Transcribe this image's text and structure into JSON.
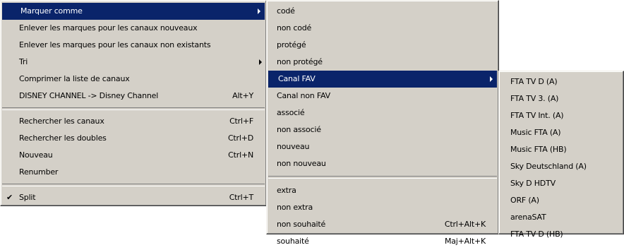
{
  "main_menu": {
    "items": [
      {
        "label": "Marquer comme",
        "shortcut": "",
        "submenu": true,
        "selected": true
      },
      {
        "label": "Enlever les marques pour les canaux nouveaux",
        "shortcut": ""
      },
      {
        "label": "Enlever les marques pour les canaux non existants",
        "shortcut": ""
      },
      {
        "label": "Tri",
        "shortcut": "",
        "submenu": true
      },
      {
        "label": "Comprimer la liste de canaux",
        "shortcut": ""
      },
      {
        "label": "DISNEY CHANNEL -> Disney Channel",
        "shortcut": "Alt+Y"
      },
      {
        "label": "Rechercher les canaux",
        "shortcut": "Ctrl+F"
      },
      {
        "label": "Rechercher les doubles",
        "shortcut": "Ctrl+D"
      },
      {
        "label": "Nouveau",
        "shortcut": "Ctrl+N"
      },
      {
        "label": "Renumber",
        "shortcut": ""
      },
      {
        "label": "Split",
        "shortcut": "Ctrl+T",
        "checked": true
      }
    ]
  },
  "mark_submenu": {
    "items": [
      {
        "label": "codé"
      },
      {
        "label": "non codé"
      },
      {
        "label": "protégé"
      },
      {
        "label": "non protégé"
      },
      {
        "label": "Canal FAV",
        "submenu": true,
        "selected": true
      },
      {
        "label": "Canal non FAV"
      },
      {
        "label": "associé"
      },
      {
        "label": "non associé"
      },
      {
        "label": "nouveau"
      },
      {
        "label": "non nouveau"
      },
      {
        "label": "extra"
      },
      {
        "label": "non extra"
      },
      {
        "label": "non souhaité",
        "shortcut": "Ctrl+Alt+K"
      },
      {
        "label": "souhaité",
        "shortcut": "Maj+Alt+K"
      }
    ]
  },
  "fav_submenu": {
    "items": [
      {
        "label": "FTA TV D (A)"
      },
      {
        "label": "FTA TV 3. (A)"
      },
      {
        "label": "FTA TV Int. (A)"
      },
      {
        "label": "Music FTA (A)"
      },
      {
        "label": "Music FTA (HB)"
      },
      {
        "label": "Sky Deutschland (A)"
      },
      {
        "label": "Sky D HDTV"
      },
      {
        "label": "ORF (A)"
      },
      {
        "label": "arenaSAT"
      },
      {
        "label": "FTA TV D (HB)"
      }
    ]
  },
  "icons": {
    "check": "✔",
    "submenu_arrow": "chevron-right-icon"
  },
  "colors": {
    "menu_bg": "#d4d0c8",
    "selection_bg": "#0a246a",
    "selection_fg": "#ffffff"
  }
}
